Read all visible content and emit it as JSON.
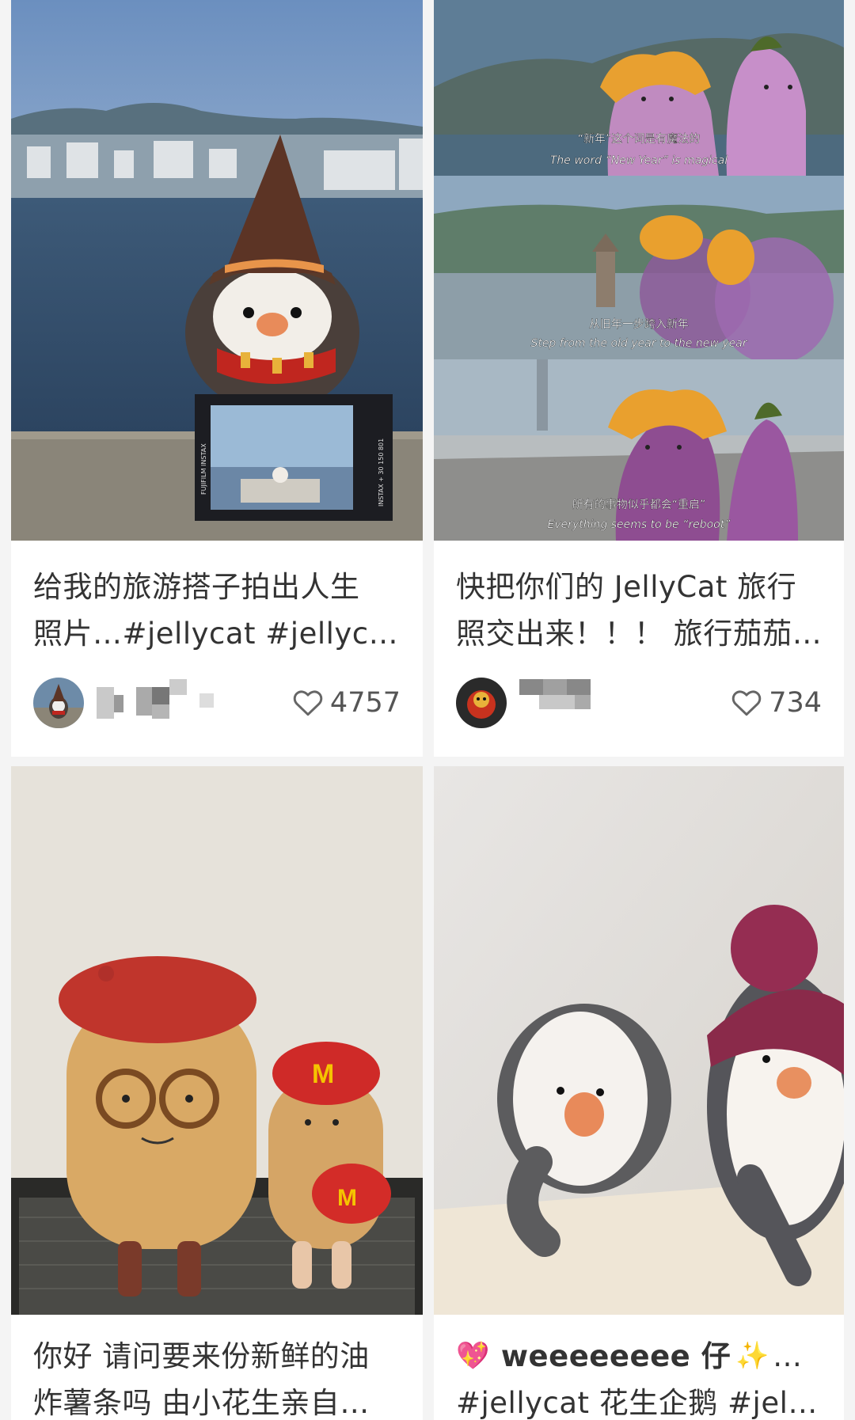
{
  "feed": {
    "cards": [
      {
        "title_line1": "给我的旅游搭子拍出人生",
        "title_line2": "照片…#jellycat #jellyca…",
        "likes": "4757",
        "photo_text": {
          "polaroid_brand": "FUJIFILM INSTAX",
          "polaroid_model": "INSTAX + 30 150 801"
        }
      },
      {
        "title_line1": "快把你们的 JellyCat 旅行",
        "title_line2": "照交出来！！！ 旅行茄茄…",
        "likes": "734",
        "subtitles": [
          {
            "cn": "“新年”这个词是有魔法的",
            "en": "The word “New Year” is magical"
          },
          {
            "cn": "从旧年一步跨入新年",
            "en": "Step from the old year to the new year"
          },
          {
            "cn": "所有的事物似乎都会“重启”",
            "en": "Everything seems to be “reboot”"
          }
        ]
      },
      {
        "title_line1": "你好 请问要来份新鲜的油",
        "title_line2": "炸薯条吗 由小花生亲自…"
      },
      {
        "title_line1_text": "weeeeeeee 仔",
        "title_line1_suffix": "…",
        "title_line2": "#jellycat 花生企鹅 #jelly…",
        "emoji_heart": "💖",
        "emoji_sparkles": "✨"
      }
    ]
  },
  "colors": {
    "background": "#f4f4f4",
    "card": "#ffffff",
    "text": "#333333",
    "like_count": "#555555"
  },
  "icons": [
    "heart-outline-icon",
    "sparkling-heart-icon",
    "sparkles-icon"
  ]
}
